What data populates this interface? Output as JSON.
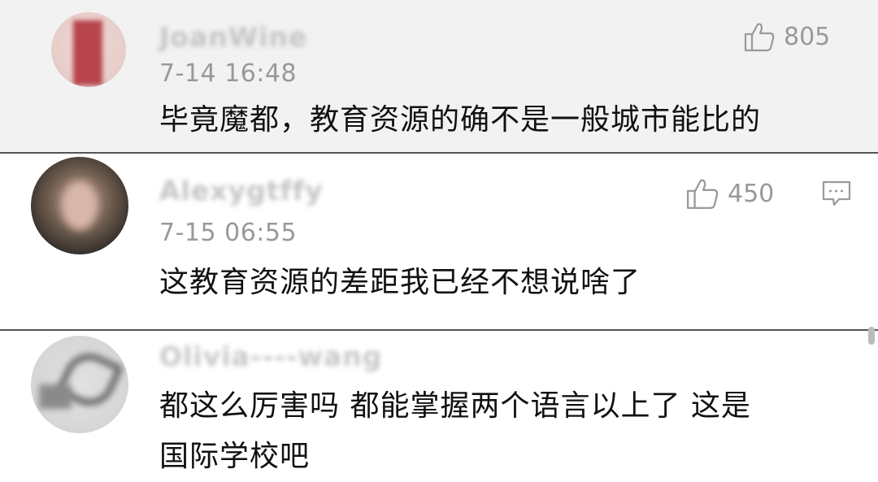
{
  "comments": [
    {
      "username": "JoanWine",
      "timestamp": "7-14 16:48",
      "text": "毕竟魔都，教育资源的确不是一般城市能比的",
      "likes": "805",
      "like_icon": "thumbs-up-icon",
      "avatar_color": "#c8606a"
    },
    {
      "username": "Alexygtffy",
      "timestamp": "7-15 06:55",
      "text": "这教育资源的差距我已经不想说啥了",
      "likes": "450",
      "like_icon": "thumbs-up-icon",
      "reply_icon": "reply-comment-icon",
      "avatar_color": "#6b5a4c"
    },
    {
      "username": "Olivia----wang",
      "text_line1": "都这么厉害吗 都能掌握两个语言以上了 这是",
      "text_line2": "国际学校吧",
      "avatar_color": "#9a9a9a"
    }
  ],
  "colors": {
    "highlight_bg": "#f2f2f2",
    "meta_gray": "#999999",
    "text": "#111111"
  }
}
